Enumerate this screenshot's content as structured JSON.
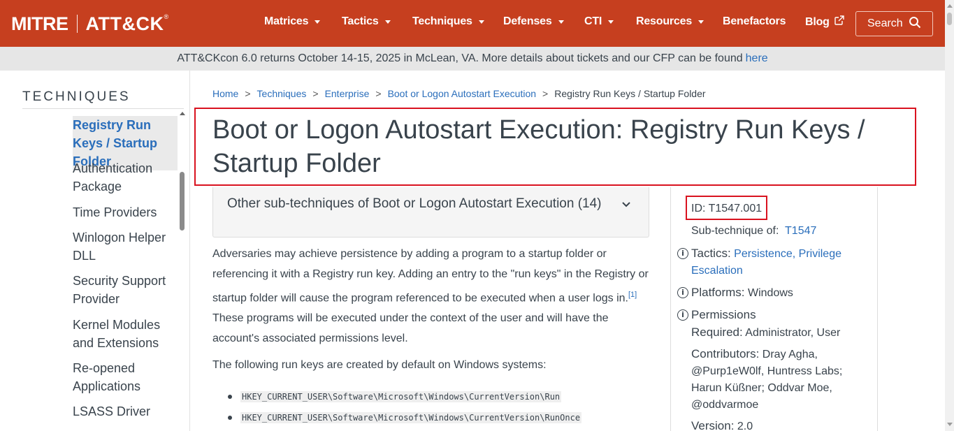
{
  "navbar": {
    "brand_mitre": "MITRE",
    "brand_attck": "ATT&CK",
    "brand_reg": "®",
    "items": [
      {
        "label": "Matrices",
        "dropdown": true
      },
      {
        "label": "Tactics",
        "dropdown": true
      },
      {
        "label": "Techniques",
        "dropdown": true
      },
      {
        "label": "Defenses",
        "dropdown": true
      },
      {
        "label": "CTI",
        "dropdown": true
      },
      {
        "label": "Resources",
        "dropdown": true
      },
      {
        "label": "Benefactors",
        "dropdown": false
      },
      {
        "label": "Blog",
        "dropdown": false,
        "icon": "external-link-icon"
      }
    ],
    "search_label": "Search",
    "search_icon": "search-icon",
    "color": "#c63f1f"
  },
  "banner": {
    "text": "ATT&CKcon 6.0 returns October 14-15, 2025 in McLean, VA. More details about tickets and our CFP can be found",
    "link": "here"
  },
  "sidebar": {
    "title": "TECHNIQUES",
    "items": [
      {
        "label": "Registry Run Keys / Startup Folder",
        "active": true
      },
      {
        "label": "Authentication Package",
        "active": false
      },
      {
        "label": "Time Providers",
        "active": false
      },
      {
        "label": "Winlogon Helper DLL",
        "active": false
      },
      {
        "label": "Security Support Provider",
        "active": false
      },
      {
        "label": "Kernel Modules and Extensions",
        "active": false
      },
      {
        "label": "Re-opened Applications",
        "active": false
      },
      {
        "label": "LSASS Driver",
        "active": false
      }
    ]
  },
  "breadcrumb": {
    "items": [
      "Home",
      "Techniques",
      "Enterprise",
      "Boot or Logon Autostart Execution"
    ],
    "current": "Registry Run Keys / Startup Folder",
    "separator": ">"
  },
  "page": {
    "title": "Boot or Logon Autostart Execution: Registry Run Keys / Startup Folder",
    "accordion_label": "Other sub-techniques of Boot or Logon Autostart Execution (14)",
    "para1": "Adversaries may achieve persistence by adding a program to a startup folder or referencing it with a Registry run key. Adding an entry to the \"run keys\" in the Registry or startup folder will cause the program referenced to be executed when a user logs in.",
    "para1_ref": "[1]",
    "para1_tail": "These programs will be executed under the context of the user and will have the account's associated permissions level.",
    "para2": "The following run keys are created by default on Windows systems:",
    "run_keys": [
      "HKEY_CURRENT_USER\\Software\\Microsoft\\Windows\\CurrentVersion\\Run",
      "HKEY_CURRENT_USER\\Software\\Microsoft\\Windows\\CurrentVersion\\RunOnce"
    ]
  },
  "card": {
    "id_label": "ID:",
    "id_value": "T1547.001",
    "subtech_label": "Sub-technique of:",
    "subtech_value": "T1547",
    "tactics_label": "Tactics:",
    "tactics_value1": "Persistence,",
    "tactics_value2": "Privilege",
    "tactics_value3": "Escalation",
    "platforms_label": "Platforms:",
    "platforms_value": "Windows",
    "perm_label1": "Permissions",
    "perm_label2": "Required:",
    "perm_value": "Administrator, User",
    "contrib_label": "Contributors:",
    "contrib_line1": "Dray Agha,",
    "contrib_line2": "@Purp1eW0lf, Huntress Labs;",
    "contrib_line3": "Harun Küßner; Oddvar Moe,",
    "contrib_line4": "@oddvarmoe",
    "version_label": "Version:",
    "version_value": "2.0"
  }
}
